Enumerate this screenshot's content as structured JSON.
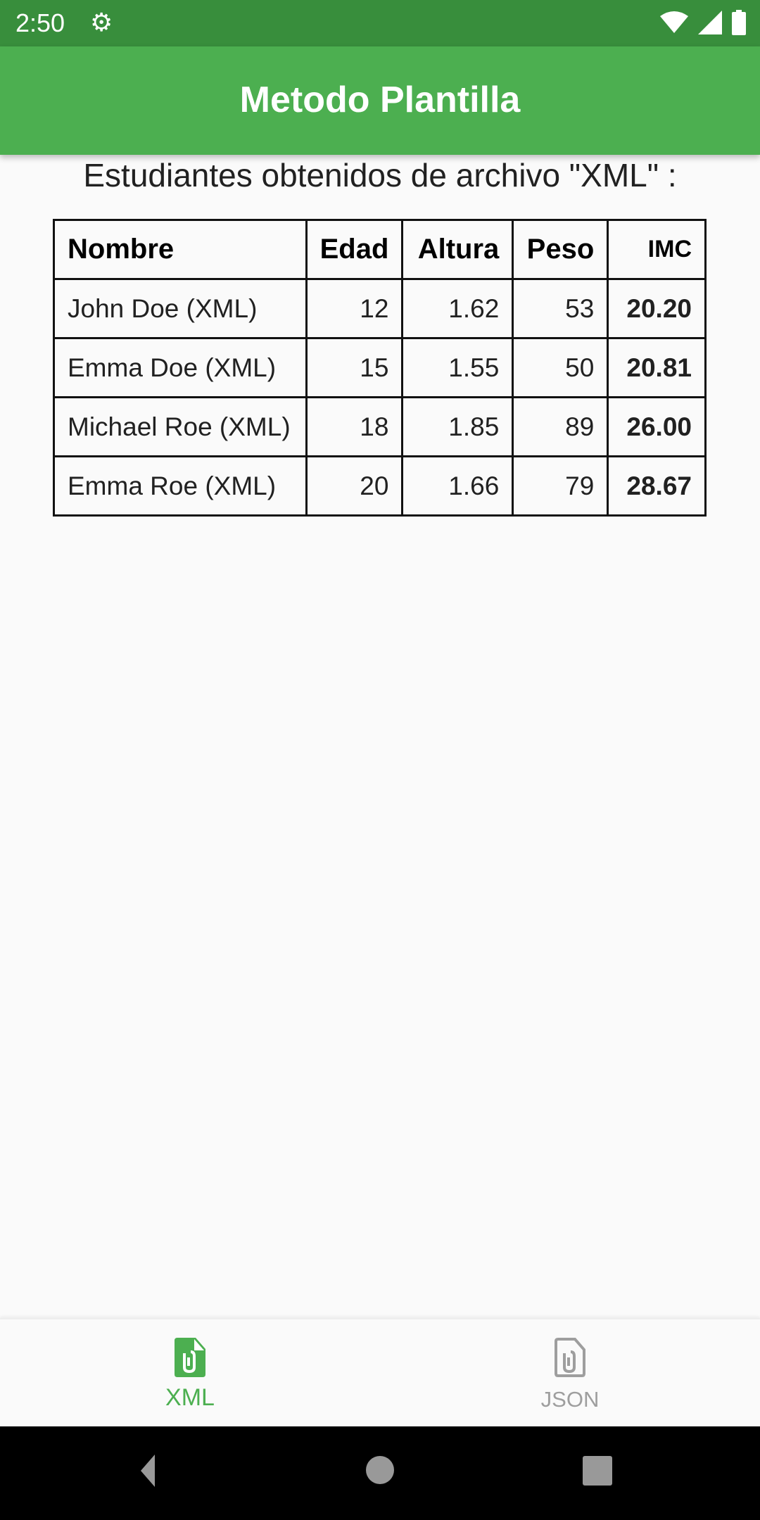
{
  "status_bar": {
    "time": "2:50",
    "icons": [
      "gear-icon",
      "wifi-icon",
      "signal-icon",
      "battery-icon"
    ]
  },
  "app_bar": {
    "title": "Metodo Plantilla"
  },
  "subtitle": "Estudiantes obtenidos de archivo \"XML\" :",
  "table": {
    "headers": [
      "Nombre",
      "Edad",
      "Altura",
      "Peso",
      "IMC"
    ],
    "rows": [
      [
        "John Doe (XML)",
        "12",
        "1.62",
        "53",
        "20.20"
      ],
      [
        "Emma Doe (XML)",
        "15",
        "1.55",
        "50",
        "20.81"
      ],
      [
        "Michael Roe (XML)",
        "18",
        "1.85",
        "89",
        "26.00"
      ],
      [
        "Emma Roe (XML)",
        "20",
        "1.66",
        "79",
        "28.67"
      ]
    ]
  },
  "bottom_nav": {
    "items": [
      {
        "label": "XML",
        "icon": "file-attachment-icon",
        "active": true
      },
      {
        "label": "JSON",
        "icon": "file-attachment-icon",
        "active": false
      }
    ],
    "active_color": "#4caf50",
    "inactive_color": "#9e9e9e"
  },
  "colors": {
    "primary": "#4caf50",
    "primary_dark": "#388e3c"
  }
}
